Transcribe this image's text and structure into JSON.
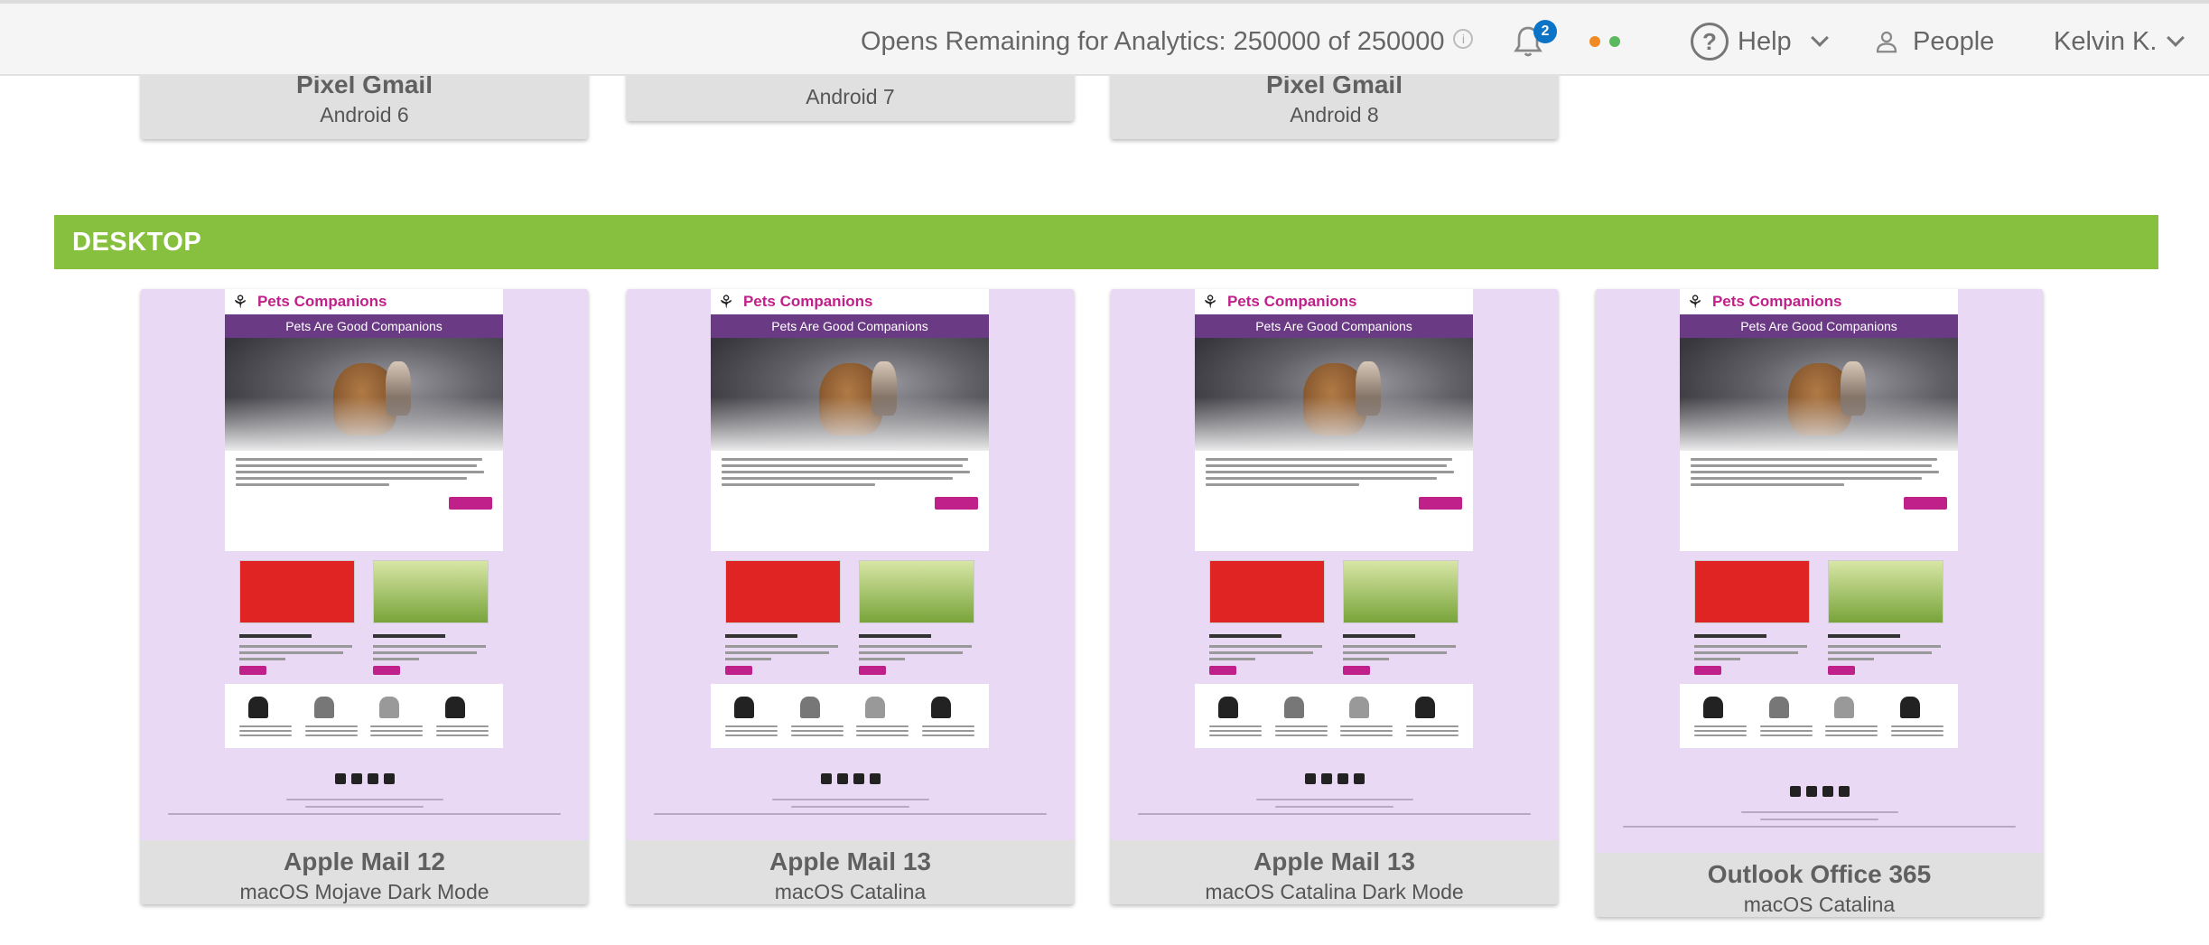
{
  "topbar": {
    "opens_text": "Opens Remaining for Analytics: 250000 of 250000",
    "notifications_count": "2",
    "help_label": "Help",
    "people_label": "People",
    "user_label": "Kelvin K.",
    "status_dot_colors": [
      "#f08a24",
      "#5cb85c"
    ]
  },
  "top_row": [
    {
      "name": "Pixel Gmail",
      "sub": "Android 6"
    },
    {
      "name": "",
      "sub": "Android 7"
    },
    {
      "name": "Pixel Gmail",
      "sub": "Android 8"
    }
  ],
  "section": {
    "title": "DESKTOP",
    "color": "#87bf3e"
  },
  "email_preview": {
    "brand": "Pets Companions",
    "header": "Pets Are Good Companions"
  },
  "desktop_clients": [
    {
      "name": "Apple Mail 12",
      "sub": "macOS Mojave Dark Mode"
    },
    {
      "name": "Apple Mail 13",
      "sub": "macOS Catalina"
    },
    {
      "name": "Apple Mail 13",
      "sub": "macOS Catalina Dark Mode"
    },
    {
      "name": "Outlook Office 365",
      "sub": "macOS Catalina"
    }
  ]
}
